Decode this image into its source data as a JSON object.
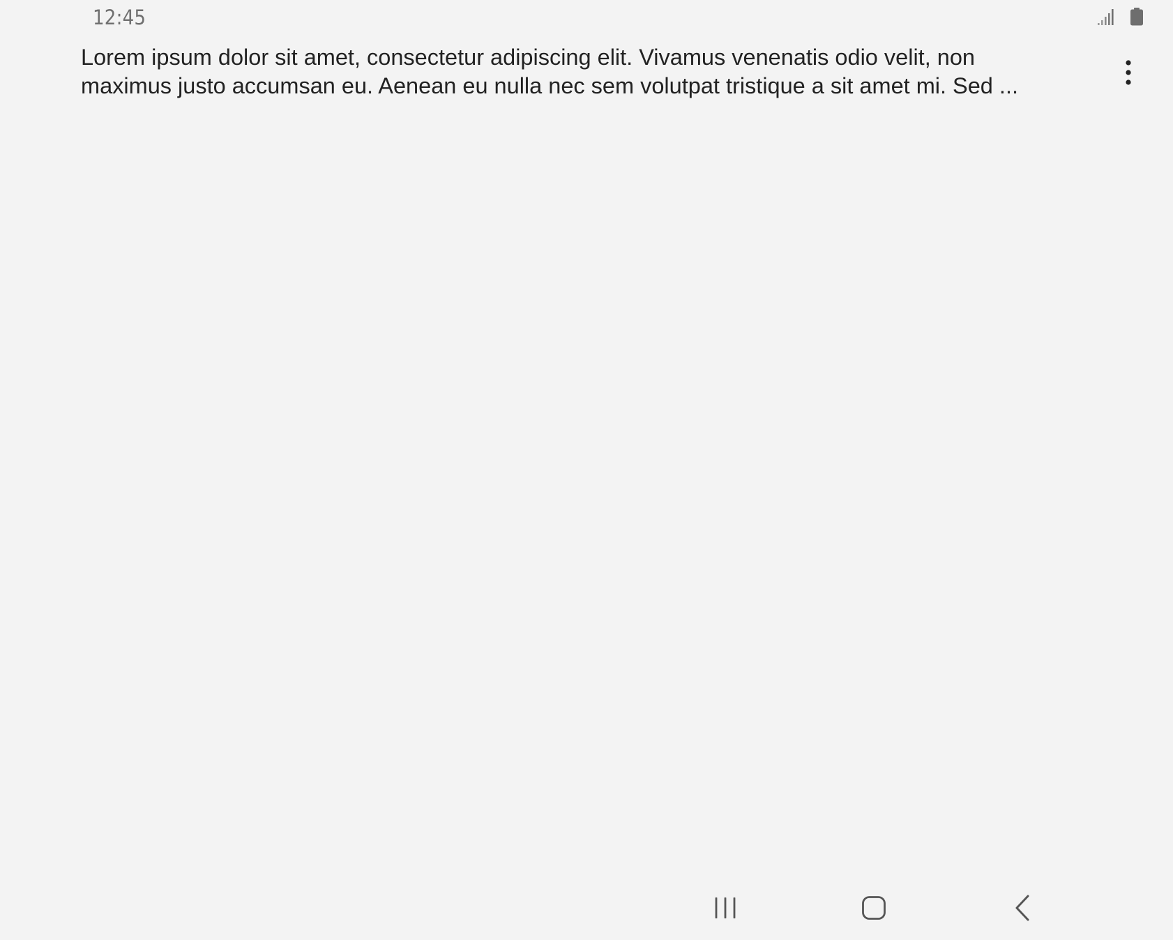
{
  "status_bar": {
    "time": "12:45",
    "icons": [
      "signal-icon",
      "battery-icon"
    ]
  },
  "content": {
    "title": "Lorem ipsum dolor sit amet, consectetur adipiscing elit. Vivamus venenatis odio velit, non\nmaximus justo accumsan eu. Aenean eu nulla nec sem volutpat tristique a sit amet mi. Sed ...",
    "more_icon": "more-vertical-icon"
  },
  "nav_bar": {
    "buttons": [
      "recents-icon",
      "home-icon",
      "back-icon"
    ]
  },
  "colors": {
    "background": "#f3f3f3",
    "text": "#222222",
    "status_text": "#707070",
    "icon": "#555555"
  }
}
